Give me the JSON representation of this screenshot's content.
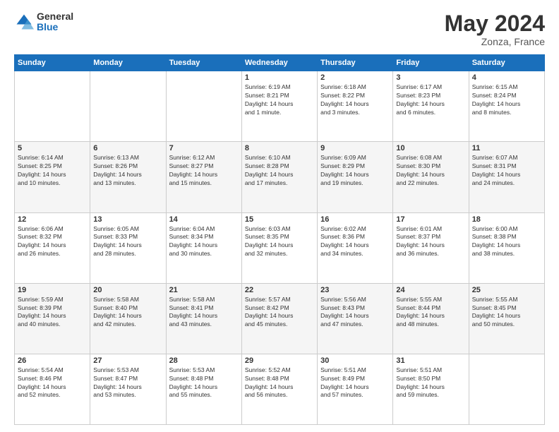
{
  "logo": {
    "general": "General",
    "blue": "Blue"
  },
  "title": "May 2024",
  "location": "Zonza, France",
  "days_of_week": [
    "Sunday",
    "Monday",
    "Tuesday",
    "Wednesday",
    "Thursday",
    "Friday",
    "Saturday"
  ],
  "weeks": [
    [
      {
        "day": "",
        "info": ""
      },
      {
        "day": "",
        "info": ""
      },
      {
        "day": "",
        "info": ""
      },
      {
        "day": "1",
        "info": "Sunrise: 6:19 AM\nSunset: 8:21 PM\nDaylight: 14 hours\nand 1 minute."
      },
      {
        "day": "2",
        "info": "Sunrise: 6:18 AM\nSunset: 8:22 PM\nDaylight: 14 hours\nand 3 minutes."
      },
      {
        "day": "3",
        "info": "Sunrise: 6:17 AM\nSunset: 8:23 PM\nDaylight: 14 hours\nand 6 minutes."
      },
      {
        "day": "4",
        "info": "Sunrise: 6:15 AM\nSunset: 8:24 PM\nDaylight: 14 hours\nand 8 minutes."
      }
    ],
    [
      {
        "day": "5",
        "info": "Sunrise: 6:14 AM\nSunset: 8:25 PM\nDaylight: 14 hours\nand 10 minutes."
      },
      {
        "day": "6",
        "info": "Sunrise: 6:13 AM\nSunset: 8:26 PM\nDaylight: 14 hours\nand 13 minutes."
      },
      {
        "day": "7",
        "info": "Sunrise: 6:12 AM\nSunset: 8:27 PM\nDaylight: 14 hours\nand 15 minutes."
      },
      {
        "day": "8",
        "info": "Sunrise: 6:10 AM\nSunset: 8:28 PM\nDaylight: 14 hours\nand 17 minutes."
      },
      {
        "day": "9",
        "info": "Sunrise: 6:09 AM\nSunset: 8:29 PM\nDaylight: 14 hours\nand 19 minutes."
      },
      {
        "day": "10",
        "info": "Sunrise: 6:08 AM\nSunset: 8:30 PM\nDaylight: 14 hours\nand 22 minutes."
      },
      {
        "day": "11",
        "info": "Sunrise: 6:07 AM\nSunset: 8:31 PM\nDaylight: 14 hours\nand 24 minutes."
      }
    ],
    [
      {
        "day": "12",
        "info": "Sunrise: 6:06 AM\nSunset: 8:32 PM\nDaylight: 14 hours\nand 26 minutes."
      },
      {
        "day": "13",
        "info": "Sunrise: 6:05 AM\nSunset: 8:33 PM\nDaylight: 14 hours\nand 28 minutes."
      },
      {
        "day": "14",
        "info": "Sunrise: 6:04 AM\nSunset: 8:34 PM\nDaylight: 14 hours\nand 30 minutes."
      },
      {
        "day": "15",
        "info": "Sunrise: 6:03 AM\nSunset: 8:35 PM\nDaylight: 14 hours\nand 32 minutes."
      },
      {
        "day": "16",
        "info": "Sunrise: 6:02 AM\nSunset: 8:36 PM\nDaylight: 14 hours\nand 34 minutes."
      },
      {
        "day": "17",
        "info": "Sunrise: 6:01 AM\nSunset: 8:37 PM\nDaylight: 14 hours\nand 36 minutes."
      },
      {
        "day": "18",
        "info": "Sunrise: 6:00 AM\nSunset: 8:38 PM\nDaylight: 14 hours\nand 38 minutes."
      }
    ],
    [
      {
        "day": "19",
        "info": "Sunrise: 5:59 AM\nSunset: 8:39 PM\nDaylight: 14 hours\nand 40 minutes."
      },
      {
        "day": "20",
        "info": "Sunrise: 5:58 AM\nSunset: 8:40 PM\nDaylight: 14 hours\nand 42 minutes."
      },
      {
        "day": "21",
        "info": "Sunrise: 5:58 AM\nSunset: 8:41 PM\nDaylight: 14 hours\nand 43 minutes."
      },
      {
        "day": "22",
        "info": "Sunrise: 5:57 AM\nSunset: 8:42 PM\nDaylight: 14 hours\nand 45 minutes."
      },
      {
        "day": "23",
        "info": "Sunrise: 5:56 AM\nSunset: 8:43 PM\nDaylight: 14 hours\nand 47 minutes."
      },
      {
        "day": "24",
        "info": "Sunrise: 5:55 AM\nSunset: 8:44 PM\nDaylight: 14 hours\nand 48 minutes."
      },
      {
        "day": "25",
        "info": "Sunrise: 5:55 AM\nSunset: 8:45 PM\nDaylight: 14 hours\nand 50 minutes."
      }
    ],
    [
      {
        "day": "26",
        "info": "Sunrise: 5:54 AM\nSunset: 8:46 PM\nDaylight: 14 hours\nand 52 minutes."
      },
      {
        "day": "27",
        "info": "Sunrise: 5:53 AM\nSunset: 8:47 PM\nDaylight: 14 hours\nand 53 minutes."
      },
      {
        "day": "28",
        "info": "Sunrise: 5:53 AM\nSunset: 8:48 PM\nDaylight: 14 hours\nand 55 minutes."
      },
      {
        "day": "29",
        "info": "Sunrise: 5:52 AM\nSunset: 8:48 PM\nDaylight: 14 hours\nand 56 minutes."
      },
      {
        "day": "30",
        "info": "Sunrise: 5:51 AM\nSunset: 8:49 PM\nDaylight: 14 hours\nand 57 minutes."
      },
      {
        "day": "31",
        "info": "Sunrise: 5:51 AM\nSunset: 8:50 PM\nDaylight: 14 hours\nand 59 minutes."
      },
      {
        "day": "",
        "info": ""
      }
    ]
  ]
}
